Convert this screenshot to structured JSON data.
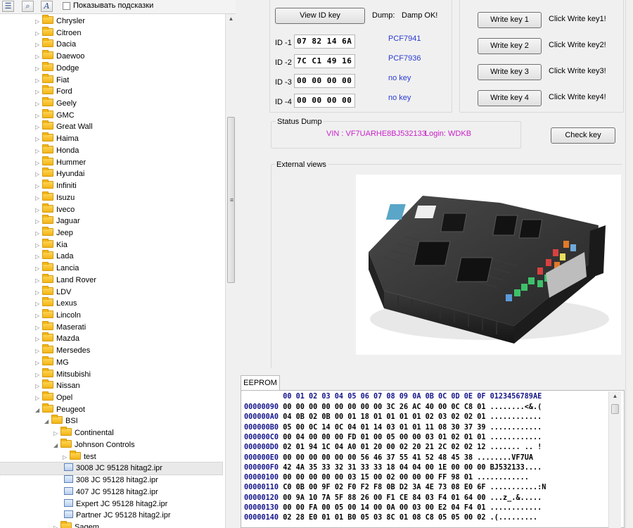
{
  "toolbar": {
    "show_hints_label": "Показывать подсказки",
    "show_hints_checked": false,
    "icons": [
      "tree-view-icon",
      "search-icon",
      "font-icon"
    ]
  },
  "tree": {
    "items": [
      {
        "label": "Chrysler",
        "level": 0,
        "type": "folder",
        "expanded": false
      },
      {
        "label": "Citroen",
        "level": 0,
        "type": "folder",
        "expanded": false
      },
      {
        "label": "Dacia",
        "level": 0,
        "type": "folder",
        "expanded": false
      },
      {
        "label": "Daewoo",
        "level": 0,
        "type": "folder",
        "expanded": false
      },
      {
        "label": "Dodge",
        "level": 0,
        "type": "folder",
        "expanded": false
      },
      {
        "label": "Fiat",
        "level": 0,
        "type": "folder",
        "expanded": false
      },
      {
        "label": "Ford",
        "level": 0,
        "type": "folder",
        "expanded": false
      },
      {
        "label": "Geely",
        "level": 0,
        "type": "folder",
        "expanded": false
      },
      {
        "label": "GMC",
        "level": 0,
        "type": "folder",
        "expanded": false
      },
      {
        "label": "Great Wall",
        "level": 0,
        "type": "folder",
        "expanded": false
      },
      {
        "label": "Haima",
        "level": 0,
        "type": "folder",
        "expanded": false
      },
      {
        "label": "Honda",
        "level": 0,
        "type": "folder",
        "expanded": false
      },
      {
        "label": "Hummer",
        "level": 0,
        "type": "folder",
        "expanded": false
      },
      {
        "label": "Hyundai",
        "level": 0,
        "type": "folder",
        "expanded": false
      },
      {
        "label": "Infiniti",
        "level": 0,
        "type": "folder",
        "expanded": false
      },
      {
        "label": "Isuzu",
        "level": 0,
        "type": "folder",
        "expanded": false
      },
      {
        "label": "Iveco",
        "level": 0,
        "type": "folder",
        "expanded": false
      },
      {
        "label": "Jaguar",
        "level": 0,
        "type": "folder",
        "expanded": false
      },
      {
        "label": "Jeep",
        "level": 0,
        "type": "folder",
        "expanded": false
      },
      {
        "label": "Kia",
        "level": 0,
        "type": "folder",
        "expanded": false
      },
      {
        "label": "Lada",
        "level": 0,
        "type": "folder",
        "expanded": false
      },
      {
        "label": "Lancia",
        "level": 0,
        "type": "folder",
        "expanded": false
      },
      {
        "label": "Land Rover",
        "level": 0,
        "type": "folder",
        "expanded": false
      },
      {
        "label": "LDV",
        "level": 0,
        "type": "folder",
        "expanded": false
      },
      {
        "label": "Lexus",
        "level": 0,
        "type": "folder",
        "expanded": false
      },
      {
        "label": "Lincoln",
        "level": 0,
        "type": "folder",
        "expanded": false
      },
      {
        "label": "Maserati",
        "level": 0,
        "type": "folder",
        "expanded": false
      },
      {
        "label": "Mazda",
        "level": 0,
        "type": "folder",
        "expanded": false
      },
      {
        "label": "Mersedes",
        "level": 0,
        "type": "folder",
        "expanded": false
      },
      {
        "label": "MG",
        "level": 0,
        "type": "folder",
        "expanded": false
      },
      {
        "label": "Mitsubishi",
        "level": 0,
        "type": "folder",
        "expanded": false
      },
      {
        "label": "Nissan",
        "level": 0,
        "type": "folder",
        "expanded": false
      },
      {
        "label": "Opel",
        "level": 0,
        "type": "folder",
        "expanded": false
      },
      {
        "label": "Peugeot",
        "level": 0,
        "type": "folder",
        "expanded": true
      },
      {
        "label": "BSI",
        "level": 1,
        "type": "folder",
        "expanded": true
      },
      {
        "label": "Continental",
        "level": 2,
        "type": "folder",
        "expanded": false
      },
      {
        "label": "Johnson Controls",
        "level": 2,
        "type": "folder",
        "expanded": true
      },
      {
        "label": "test",
        "level": 3,
        "type": "folder",
        "expanded": false
      },
      {
        "label": "3008 JC 95128 hitag2.ipr",
        "level": 3,
        "type": "file",
        "selected": true
      },
      {
        "label": "308 JC 95128 hitag2.ipr",
        "level": 3,
        "type": "file"
      },
      {
        "label": "407 JC 95128 hitag2.ipr",
        "level": 3,
        "type": "file"
      },
      {
        "label": "Expert JC 95128 hitag2.ipr",
        "level": 3,
        "type": "file"
      },
      {
        "label": "Partner JC 95128 hitag2.ipr",
        "level": 3,
        "type": "file"
      },
      {
        "label": "Sagem",
        "level": 2,
        "type": "folder",
        "expanded": false
      }
    ]
  },
  "id_panel": {
    "view_button": "View ID key",
    "dump_label": "Dump:",
    "dump_status": "Damp OK!",
    "ids": [
      {
        "label": "ID -1",
        "value": "07 82 14 6A",
        "type": "PCF7941"
      },
      {
        "label": "ID -2",
        "value": "7C C1 49 16",
        "type": "PCF7936"
      },
      {
        "label": "ID -3",
        "value": "00 00 00 00",
        "type": "no key"
      },
      {
        "label": "ID -4",
        "value": "00 00 00 00",
        "type": "no key"
      }
    ]
  },
  "write_panel": {
    "rows": [
      {
        "button": "Write key 1",
        "message": "Click Write key1!"
      },
      {
        "button": "Write key 2",
        "message": "Click Write key2!"
      },
      {
        "button": "Write key 3",
        "message": "Click Write key3!"
      },
      {
        "button": "Write key 4",
        "message": "Click Write key4!"
      }
    ]
  },
  "status_dump": {
    "title": "Status Dump",
    "vin": "VIN : VF7UARHE8BJ532133",
    "login": "Login: WDKB",
    "check_button": "Check key"
  },
  "external_views": {
    "title": "External views",
    "image_name": "bsi-module-photo"
  },
  "eeprom": {
    "tab_label": "EEPROM",
    "columns": [
      "00",
      "01",
      "02",
      "03",
      "04",
      "05",
      "06",
      "07",
      "08",
      "09",
      "0A",
      "0B",
      "0C",
      "0D",
      "0E",
      "0F"
    ],
    "ascii_header": "0123456789AE",
    "rows": [
      {
        "addr": "00000090",
        "bytes": "00 00 00 00 00 00 00 00 3C 26 AC 40 00 0C C8 01",
        "ascii": "........<&.("
      },
      {
        "addr": "000000A0",
        "bytes": "04 0B 02 0B 00 01 18 01 01 01 01 02 03 02 02 01",
        "ascii": "............"
      },
      {
        "addr": "000000B0",
        "bytes": "05 00 0C 14 0C 04 01 14 03 01 01 11 08 30 37 39",
        "ascii": "............"
      },
      {
        "addr": "000000C0",
        "bytes": "00 04 00 00 00 FD 01 00 05 00 00 03 01 02 01 01",
        "ascii": "............"
      },
      {
        "addr": "000000D0",
        "bytes": "02 01 94 1C 04 A0 01 20 00 02 20 21 2C 02 02 12",
        "ascii": "....... .. !"
      },
      {
        "addr": "000000E0",
        "bytes": "00 00 00 00 00 00 56 46 37 55 41 52 48 45 38",
        "ascii": "........VF7UA"
      },
      {
        "addr": "000000F0",
        "bytes": "42 4A 35 33 32 31 33 33 18 04 04 00 1E 00 00 00",
        "ascii": "BJ532133...."
      },
      {
        "addr": "00000100",
        "bytes": "00 00 00 00 00 03 15 00 02 00 00 00 FF 98 01",
        "ascii": "............"
      },
      {
        "addr": "00000110",
        "bytes": "C0 0B 00 9F 02 F0 F2 F8 0B D2 3A 4E 73 08 E0 6F",
        "ascii": "...........:N"
      },
      {
        "addr": "00000120",
        "bytes": "00 9A 10 7A 5F 88 26 00 F1 CE 84 03 F4 01 64 00",
        "ascii": "...z_.&....."
      },
      {
        "addr": "00000130",
        "bytes": "00 00 FA 00 05 00 14 00 0A 00 03 00 E2 04 F4 01",
        "ascii": "............"
      },
      {
        "addr": "00000140",
        "bytes": "02 28 E0 01 01 B0 05 03 8C 01 08 C8 05 05 00 02",
        "ascii": ".(........."
      }
    ]
  },
  "colors": {
    "blue_text": "#2a3bd1",
    "magenta_text": "#c81fc8",
    "hex_address": "#14148a",
    "folder": "#f3b514"
  }
}
